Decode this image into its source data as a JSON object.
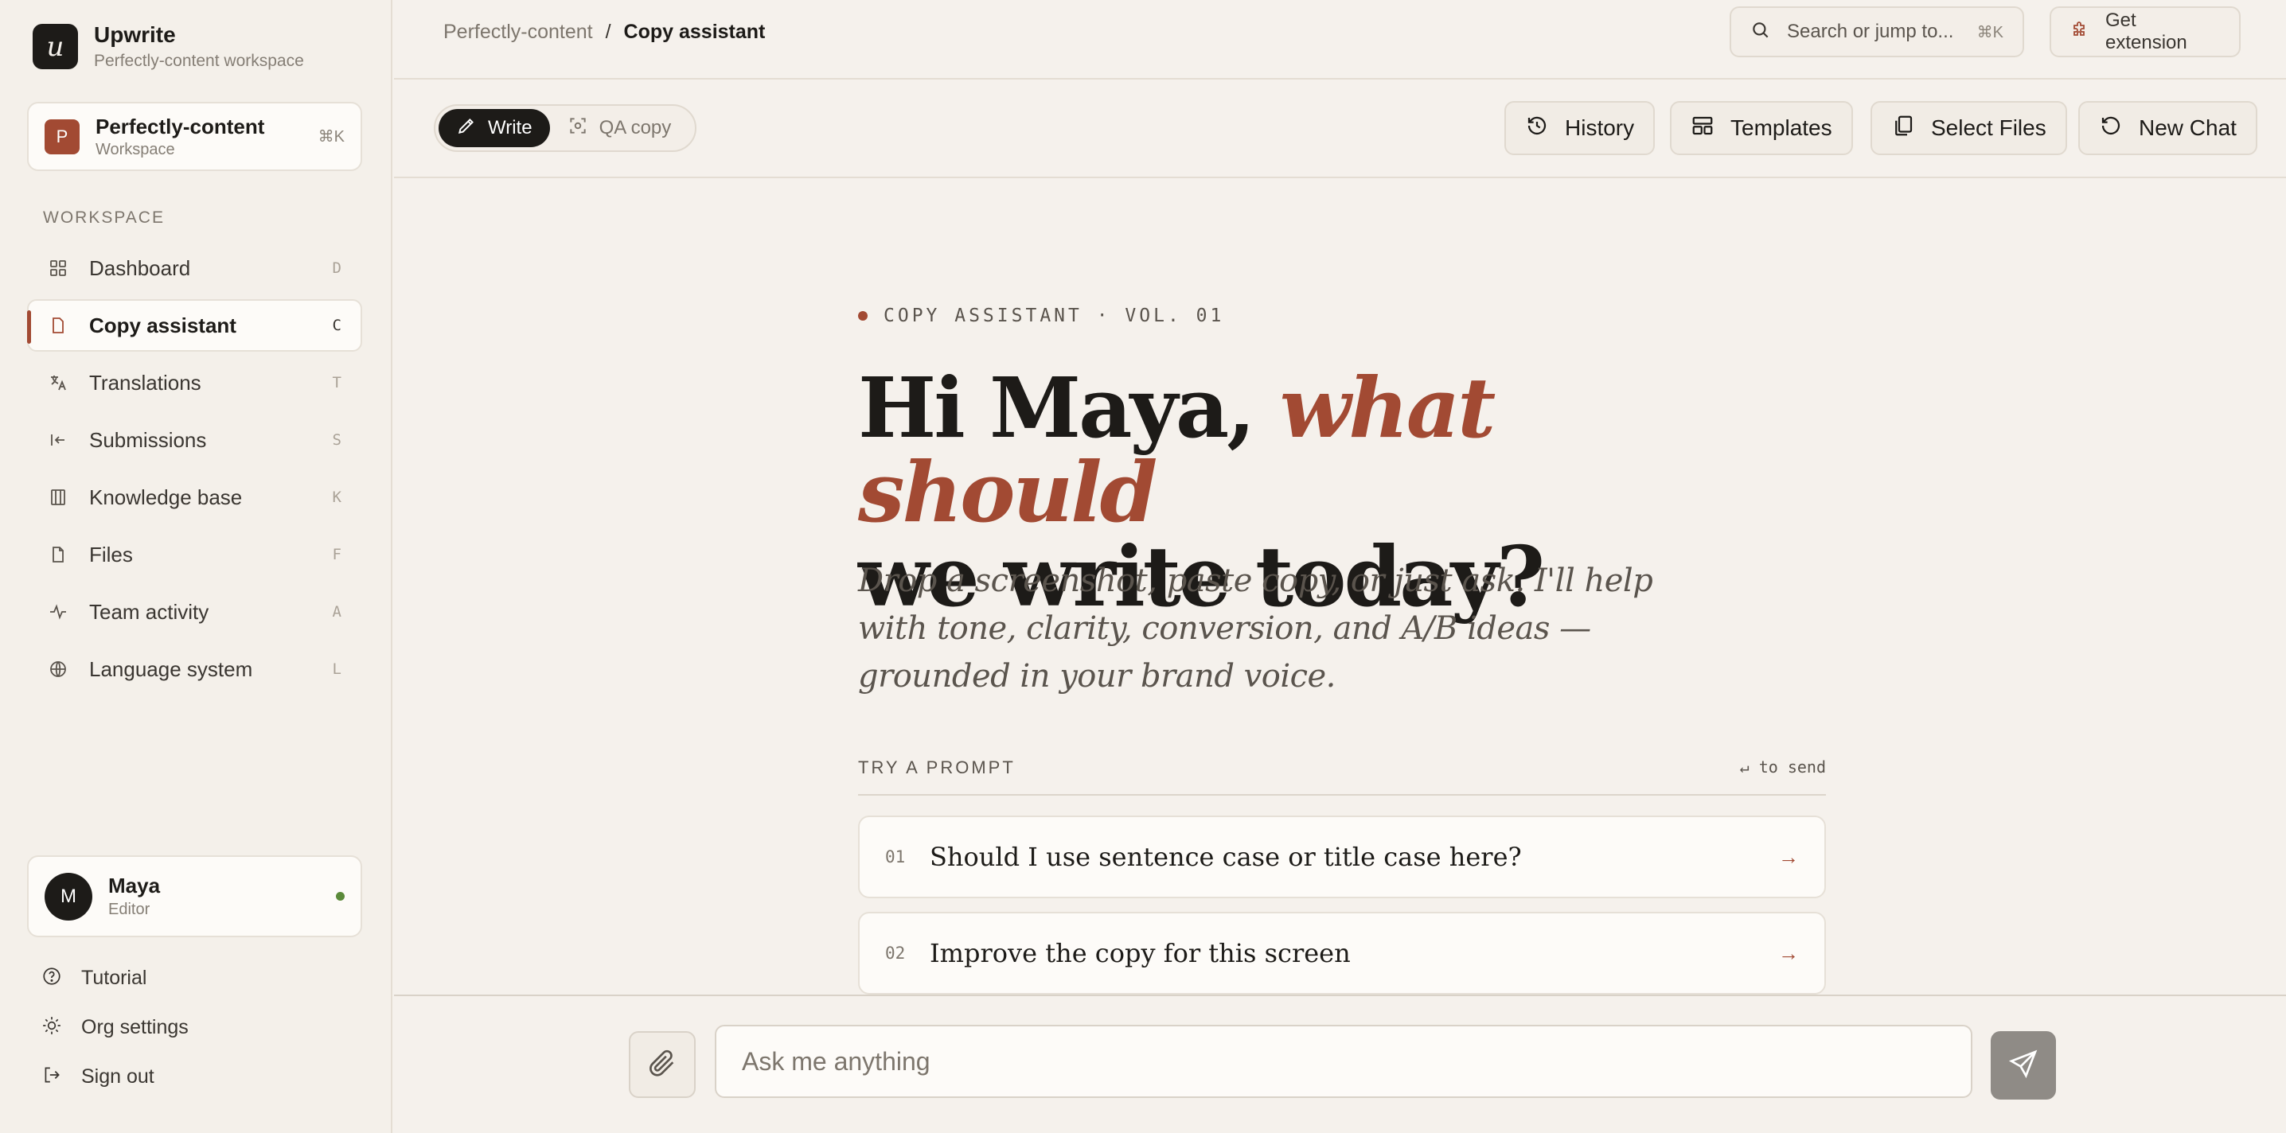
{
  "brand": {
    "logo_letter": "u",
    "name": "Upwrite",
    "workspace_line": "Perfectly-content workspace"
  },
  "workspace": {
    "avatar_letter": "P",
    "name": "Perfectly-content",
    "role": "Workspace",
    "shortcut": "⌘K"
  },
  "sidebar": {
    "section_label": "WORKSPACE",
    "items": [
      {
        "label": "Dashboard",
        "key": "D",
        "icon": "grid-icon",
        "active": false
      },
      {
        "label": "Copy assistant",
        "key": "C",
        "icon": "document-icon",
        "active": true
      },
      {
        "label": "Translations",
        "key": "T",
        "icon": "translate-icon",
        "active": false
      },
      {
        "label": "Submissions",
        "key": "S",
        "icon": "arrow-in-icon",
        "active": false
      },
      {
        "label": "Knowledge base",
        "key": "K",
        "icon": "book-columns-icon",
        "active": false
      },
      {
        "label": "Files",
        "key": "F",
        "icon": "file-icon",
        "active": false
      },
      {
        "label": "Team activity",
        "key": "A",
        "icon": "activity-icon",
        "active": false
      },
      {
        "label": "Language system",
        "key": "L",
        "icon": "globe-icon",
        "active": false
      }
    ]
  },
  "user": {
    "avatar_letter": "M",
    "name": "Maya",
    "role": "Editor",
    "status": "online"
  },
  "footer_links": [
    {
      "label": "Tutorial",
      "icon": "help-circle-icon"
    },
    {
      "label": "Org settings",
      "icon": "settings-sun-icon"
    },
    {
      "label": "Sign out",
      "icon": "sign-out-icon"
    }
  ],
  "breadcrumb": {
    "parent": "Perfectly-content",
    "separator": "/",
    "current": "Copy assistant"
  },
  "search": {
    "placeholder": "Search or jump to...",
    "shortcut": "⌘K"
  },
  "extension_button": "Get extension",
  "mode_toggle": {
    "write": "Write",
    "qa": "QA copy",
    "active": "write"
  },
  "toolbar": {
    "history": "History",
    "templates": "Templates",
    "select_files": "Select Files",
    "new_chat": "New Chat"
  },
  "main": {
    "eyebrow": "COPY ASSISTANT · VOL. 01",
    "greeting_plain": "Hi Maya, ",
    "greeting_accent": "what should",
    "greeting_line2": "we write today?",
    "subtitle": "Drop a screenshot, paste copy, or just ask. I'll help with tone, clarity, conversion, and A/B ideas — grounded in your brand voice.",
    "try_label": "TRY A PROMPT",
    "send_hint": "↵ to send",
    "prompts": [
      {
        "num": "01",
        "text": "Should I use sentence case or title case here?"
      },
      {
        "num": "02",
        "text": "Improve the copy for this screen"
      }
    ]
  },
  "composer": {
    "placeholder": "Ask me anything",
    "value": ""
  },
  "colors": {
    "accent": "#a24a33",
    "ink": "#1d1b18",
    "background": "#f5f1ec",
    "online": "#5b8a3a"
  }
}
